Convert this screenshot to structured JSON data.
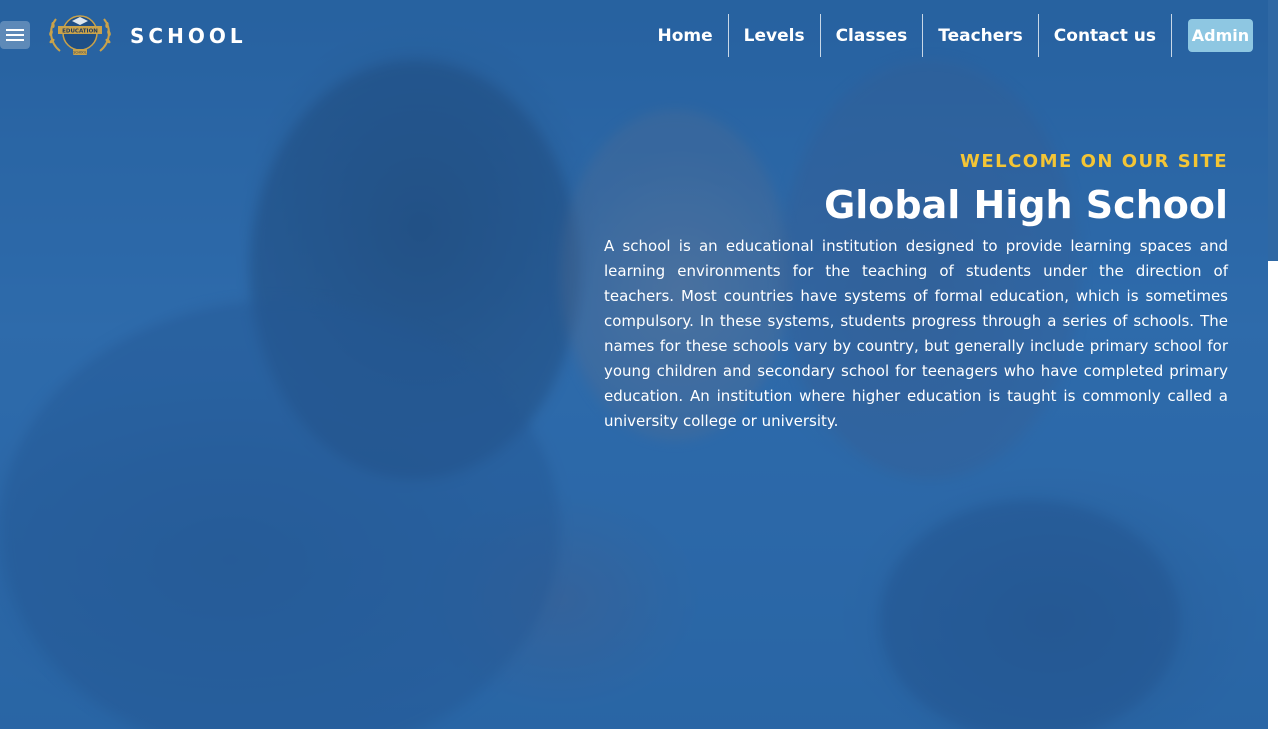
{
  "navbar": {
    "brand": "SCHOOL",
    "logo_text": "EDUCATION",
    "logo_subtext": "SCHOOL",
    "links": [
      {
        "label": "Home"
      },
      {
        "label": "Levels"
      },
      {
        "label": "Classes"
      },
      {
        "label": "Teachers"
      },
      {
        "label": "Contact us"
      }
    ],
    "admin_label": "Admin"
  },
  "hero": {
    "eyebrow": "WELCOME ON OUR SITE",
    "title": "Global High School",
    "description": "A school is an educational institution designed to provide learning spaces and learning environments for the teaching of students under the direction of teachers. Most countries have systems of formal education, which is sometimes compulsory. In these systems, students progress through a series of schools. The names for these schools vary by country, but generally include primary school for young children and secondary school for teenagers who have completed primary education. An institution where higher education is taught is commonly called a university college or university."
  },
  "colors": {
    "overlay": "#2564aa",
    "accent_yellow": "#f4c535",
    "admin_button": "#8ec7e2",
    "text": "#ffffff"
  },
  "icons": {
    "menu": "hamburger-menu-icon",
    "logo": "laurel-wreath-logo"
  }
}
